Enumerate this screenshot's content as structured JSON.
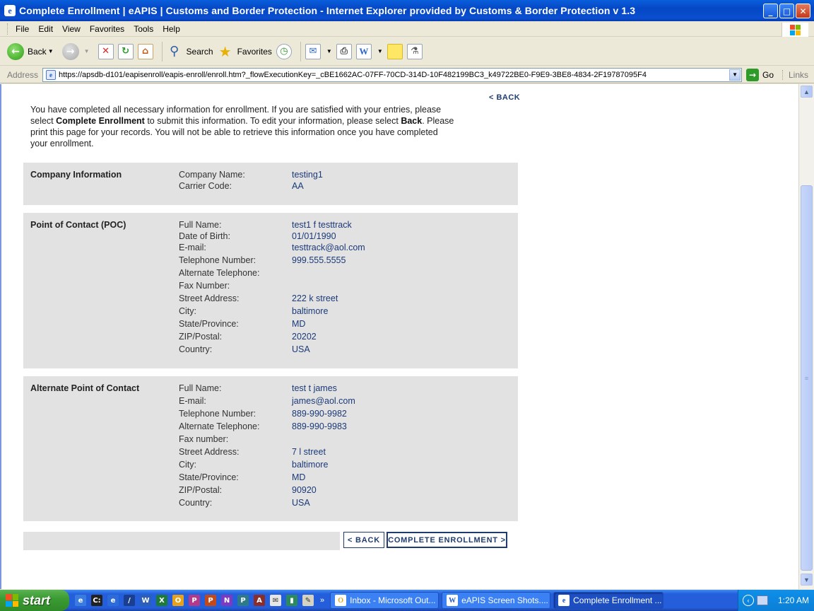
{
  "window": {
    "title": "Complete Enrollment | eAPIS | Customs and Border Protection - Internet Explorer provided by Customs & Border Protection v 1.3"
  },
  "menu": [
    "File",
    "Edit",
    "View",
    "Favorites",
    "Tools",
    "Help"
  ],
  "toolbar": {
    "back_label": "Back",
    "search_label": "Search",
    "favorites_label": "Favorites"
  },
  "address": {
    "label": "Address",
    "url": "https://apsdb-d101/eapisenroll/eapis-enroll/enroll.htm?_flowExecutionKey=_cBE1662AC-07FF-70CD-314D-10F482199BC3_k49722BE0-F9E9-3BE8-4834-2F19787095F4",
    "go_label": "Go",
    "links_label": "Links"
  },
  "page": {
    "top_back_link": "< BACK",
    "intro_part1": "You have completed all necessary information for enrollment. If you are satisfied with your entries, please select ",
    "intro_bold1": "Complete Enrollment",
    "intro_part2": " to submit this information. To edit your information, please select ",
    "intro_bold2": "Back",
    "intro_part3": ". Please print this page for your records. You will not be able to retrieve this information once you have completed your enrollment.",
    "company": {
      "title": "Company Information",
      "fields": [
        {
          "label": "Company Name:",
          "value": "testing1"
        },
        {
          "label": "Carrier Code:",
          "value": "AA"
        }
      ]
    },
    "poc": {
      "title": "Point of Contact (POC)",
      "fields": [
        {
          "label": "Full Name:",
          "value": "test1 f testtrack"
        },
        {
          "label": "Date of Birth:",
          "value": "01/01/1990"
        },
        {
          "label": "E-mail:",
          "value": "testtrack@aol.com"
        },
        {
          "label": "Telephone Number:",
          "value": "999.555.5555"
        },
        {
          "label": "Alternate Telephone:",
          "value": ""
        },
        {
          "label": "Fax Number:",
          "value": ""
        },
        {
          "label": "Street Address:",
          "value": "222 k street"
        },
        {
          "label": "City:",
          "value": "baltimore"
        },
        {
          "label": "State/Province:",
          "value": "MD"
        },
        {
          "label": "ZIP/Postal:",
          "value": "20202"
        },
        {
          "label": "Country:",
          "value": "USA"
        }
      ]
    },
    "alt_poc": {
      "title": "Alternate Point of Contact",
      "fields": [
        {
          "label": "Full Name:",
          "value": "test t james"
        },
        {
          "label": "E-mail:",
          "value": "james@aol.com"
        },
        {
          "label": "Telephone Number:",
          "value": "889-990-9982"
        },
        {
          "label": "Alternate Telephone:",
          "value": "889-990-9983"
        },
        {
          "label": "Fax number:",
          "value": ""
        },
        {
          "label": "Street Address:",
          "value": "7 l street"
        },
        {
          "label": "City:",
          "value": "baltimore"
        },
        {
          "label": "State/Province:",
          "value": "MD"
        },
        {
          "label": "ZIP/Postal:",
          "value": "90920"
        },
        {
          "label": "Country:",
          "value": "USA"
        }
      ]
    },
    "back_button": "< BACK",
    "complete_button": "COMPLETE ENROLLMENT >"
  },
  "taskbar": {
    "start_label": "start",
    "tasks": [
      {
        "label": "Inbox - Microsoft Out...",
        "icon": "outlook-icon"
      },
      {
        "label": "eAPIS Screen Shots....",
        "icon": "word-icon"
      },
      {
        "label": "Complete Enrollment ...",
        "icon": "ie-icon",
        "active": true
      }
    ],
    "clock": "1:20 AM"
  },
  "colors": {
    "section_bg": "#e2e2e2",
    "value_text": "#1b3a78",
    "button_border": "#1f3c6e",
    "titlebar": "#0547c4",
    "taskbar": "#245edb",
    "start": "#3c9c33"
  }
}
